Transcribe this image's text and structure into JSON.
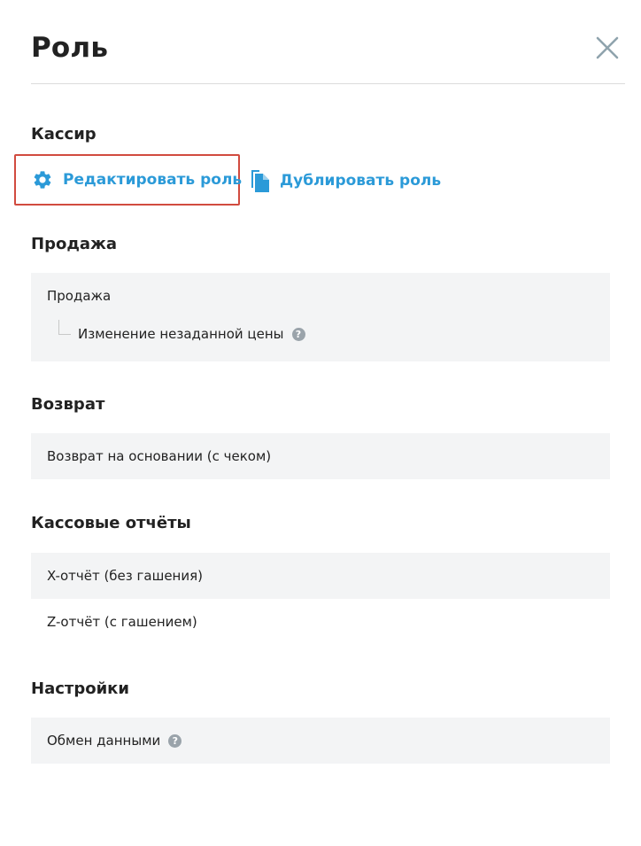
{
  "header": {
    "title": "Роль"
  },
  "role": {
    "name": "Кассир",
    "edit_label": "Редактировать роль",
    "duplicate_label": "Дублировать роль"
  },
  "sections": {
    "sale": {
      "title": "Продажа",
      "items": [
        {
          "label": "Продажа"
        },
        {
          "label": "Изменение незаданной цены",
          "help": "?"
        }
      ]
    },
    "return": {
      "title": "Возврат",
      "items": [
        {
          "label": "Возврат на основании (с чеком)"
        }
      ]
    },
    "reports": {
      "title": "Кассовые отчёты",
      "items": [
        {
          "label": "X-отчёт (без гашения)"
        },
        {
          "label": "Z-отчёт (с гашением)"
        }
      ]
    },
    "settings": {
      "title": "Настройки",
      "items": [
        {
          "label": "Обмен данными",
          "help": "?"
        }
      ]
    }
  },
  "colors": {
    "accent": "#2b9ad8",
    "highlight_border": "#d14b3f",
    "row_background": "#f3f4f5",
    "help_icon": "#9aa3aa"
  },
  "icons": {
    "close": "close-icon",
    "edit": "gear-icon",
    "duplicate": "copy-icon",
    "help": "help-icon"
  }
}
